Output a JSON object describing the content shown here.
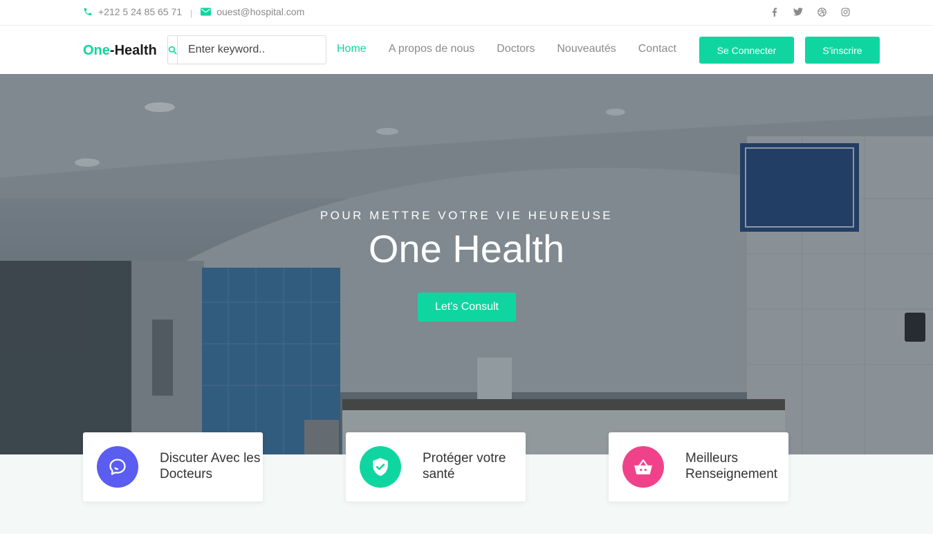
{
  "topbar": {
    "phone": "+212 5 24 85 65 71",
    "email": "ouest@hospital.com",
    "separator": "|",
    "social": [
      "facebook-icon",
      "twitter-icon",
      "dribbble-icon",
      "instagram-icon"
    ]
  },
  "nav": {
    "logo_accent": "One",
    "logo_rest": "-Health",
    "search_placeholder": "Enter keyword..",
    "links": [
      "Home",
      "A propos de nous",
      "Doctors",
      "Nouveautés",
      "Contact"
    ],
    "active": "Home",
    "login_label": "Se Connecter",
    "signup_label": "S'inscrire"
  },
  "hero": {
    "subtitle": "POUR METTRE VOTRE VIE HEUREUSE",
    "title": "One Health",
    "cta_label": "Let's Consult"
  },
  "features": [
    {
      "label": "Discuter Avec les Docteurs",
      "icon": "chat-icon",
      "color": "#5a5df0"
    },
    {
      "label": "Protéger votre santé",
      "icon": "shield-check-icon",
      "color": "#0fd6a0"
    },
    {
      "label": "Meilleurs Renseignement",
      "icon": "basket-icon",
      "color": "#f0428a"
    }
  ],
  "colors": {
    "accent": "#0fd6a0"
  }
}
